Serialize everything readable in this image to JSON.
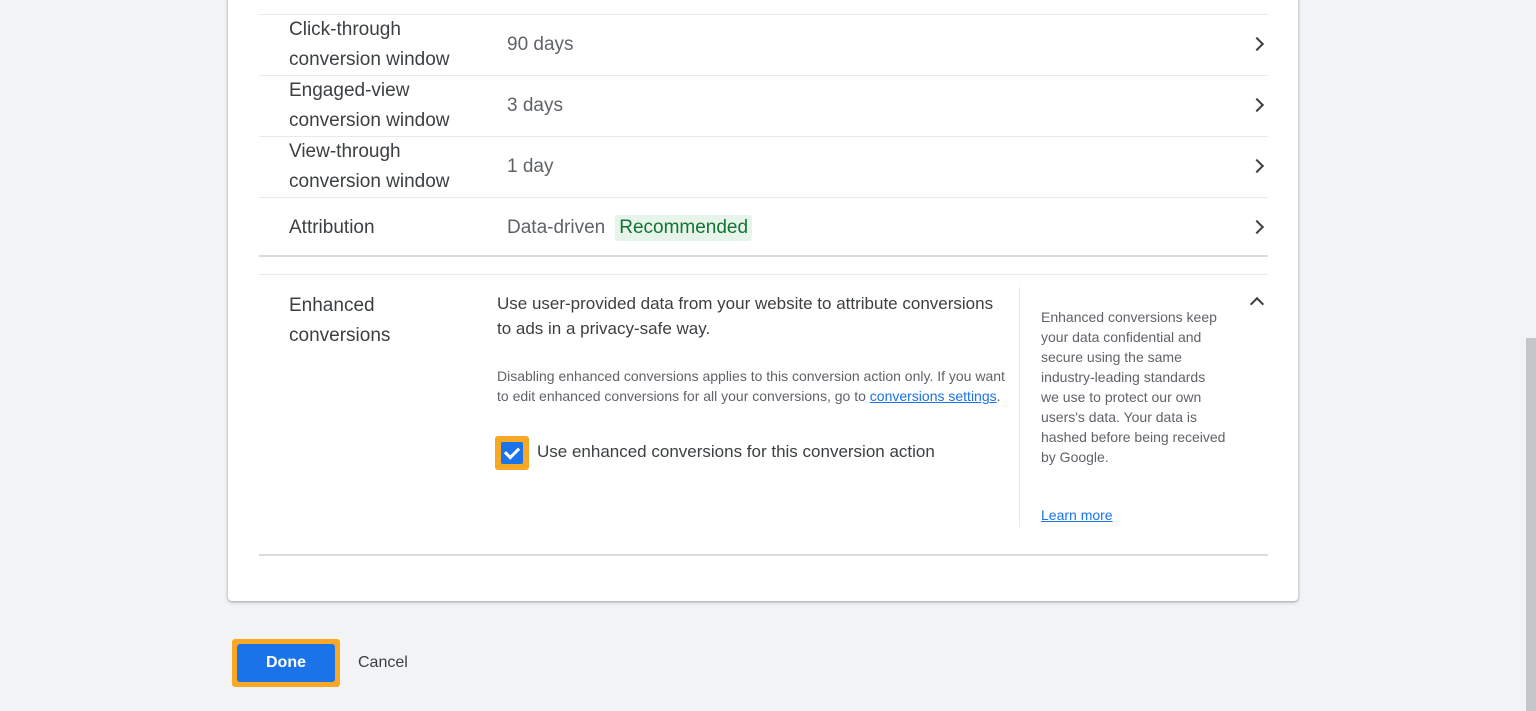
{
  "settings_rows": [
    {
      "label": "Click-through conversion window",
      "value": "90 days"
    },
    {
      "label": "Engaged-view conversion window",
      "value": "3 days"
    },
    {
      "label": "View-through conversion window",
      "value": "1 day"
    },
    {
      "label": "Attribution",
      "value": "Data-driven",
      "badge": "Recommended"
    }
  ],
  "enhanced": {
    "title": "Enhanced conversions",
    "description": "Use user-provided data from your website to attribute conversions to ads in a privacy-safe way.",
    "note_prefix": "Disabling enhanced conversions applies to this conversion action only. If you want to edit enhanced conversions for all your conversions, go to ",
    "note_link": "conversions settings",
    "note_suffix": ".",
    "checkbox_label": "Use enhanced conversions for this conversion action",
    "checkbox_checked": true,
    "side_text": "Enhanced conversions keep your data confidential and secure using the same industry-leading standards we use to protect our own users's data. Your data is hashed before being received by Google.",
    "side_link": "Learn more"
  },
  "actions": {
    "done_label": "Done",
    "cancel_label": "Cancel"
  },
  "colors": {
    "primary": "#1a73e8",
    "highlight": "#f9a825",
    "badge_bg": "#e6f4ea",
    "badge_text": "#137333"
  }
}
